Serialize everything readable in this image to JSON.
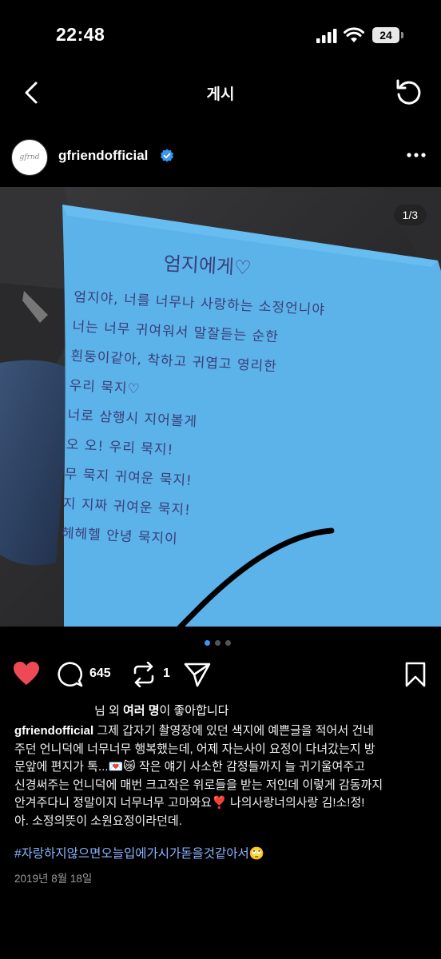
{
  "status_bar": {
    "time": "22:48",
    "battery": "24"
  },
  "nav": {
    "title": "게시"
  },
  "post": {
    "username": "gfriendofficial",
    "image_counter": "1/3",
    "letter": {
      "title": "엄지에게♡",
      "lines": [
        "엄지야, 너를 너무나 사랑하는 소정언니야",
        "너는 너무 귀여워서 말잘듣는 순한",
        "흰둥이같아, 착하고 귀엽고 영리한",
        "우리 묵지♡",
        "너로 삼행시 지어볼게",
        "오 오! 우리 묵지!",
        "무 묵지 귀여운 묵지!",
        "지 지짜 귀여운 묵지!",
        "헤헤헬 안녕 묵지이"
      ]
    },
    "like_count": "645",
    "share_count": "1",
    "likes_text_prefix": "님 외 ",
    "likes_text_bold": "여러 명",
    "likes_text_suffix": "이 좋아합니다",
    "caption_username": "gfriendofficial",
    "caption_line1": " 그제 갑자기 촬영장에 있던 색지에 예쁜글을 적어서 건네",
    "caption_line2": "주던 언니덕에 너무너무 행복했는데, 어제 자는사이 요정이 다녀갔는지 방",
    "caption_line3": "문앞에 편지가 톡...💌😿 작은 얘기 사소한 감정들까지 늘 귀기울여주고",
    "caption_line4": "신경써주는 언니덕에 매번 크고작은 위로들을 받는 저인데 이렇게 감동까지",
    "caption_line5": "안겨주다니 정말이지 너무너무 고마와요❣️ 나의사랑너의사랑 김!소!정!",
    "caption_line6": "아. 소정의뜻이 소원요정이라던데.",
    "hashtag": "#자랑하지않으면오늘입에가시가돋을것같아서🙄",
    "date": "2019년 8월 18일"
  },
  "colors": {
    "accent_like": "#ed4956",
    "hashtag": "#8ab4ff",
    "paper": "#5cb3ea",
    "verified": "#3897f0"
  }
}
